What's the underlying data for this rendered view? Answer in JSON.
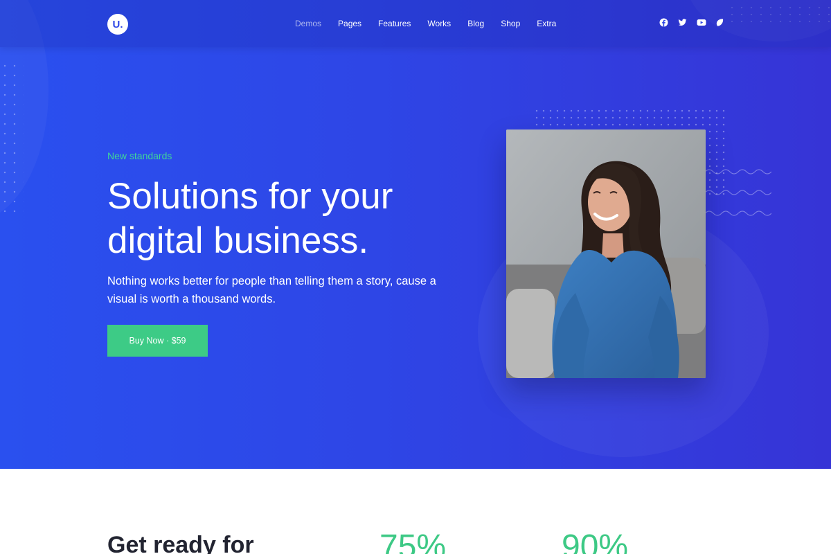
{
  "header": {
    "logo_text": "U.",
    "nav": [
      {
        "label": "Demos",
        "active": true
      },
      {
        "label": "Pages",
        "active": false
      },
      {
        "label": "Features",
        "active": false
      },
      {
        "label": "Works",
        "active": false
      },
      {
        "label": "Blog",
        "active": false
      },
      {
        "label": "Shop",
        "active": false
      },
      {
        "label": "Extra",
        "active": false
      }
    ],
    "social_icons": [
      "facebook-icon",
      "twitter-icon",
      "youtube-icon",
      "dribbble-icon"
    ]
  },
  "hero": {
    "eyebrow": "New standards",
    "headline_line1": "Solutions for your",
    "headline_line2": "digital business.",
    "lead_line1": "Nothing works better for people than telling them a story, cause a",
    "lead_line2": "visual is worth a thousand words.",
    "cta_label": "Buy Now · $59"
  },
  "stats": {
    "heading": "Get ready for",
    "values": [
      "75%",
      "90%"
    ]
  },
  "colors": {
    "hero_gradient_start": "#2a50ef",
    "hero_gradient_end": "#3634d6",
    "accent_green": "#3dcb86",
    "heading_dark": "#222431"
  }
}
